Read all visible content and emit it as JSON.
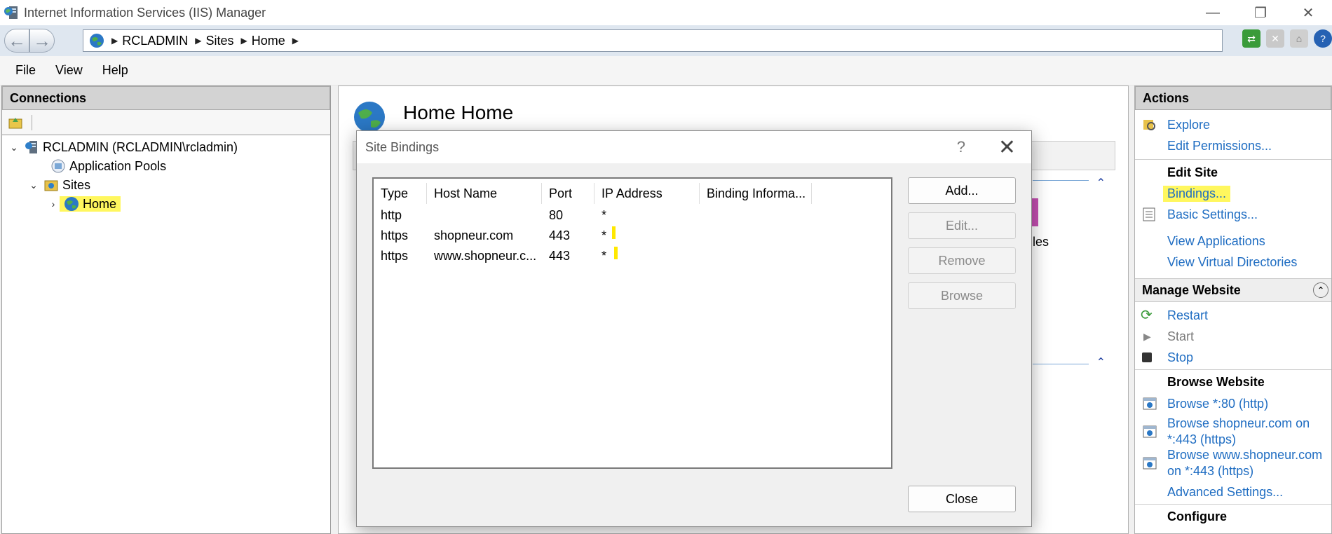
{
  "window": {
    "title": "Internet Information Services (IIS) Manager",
    "minimize": "—",
    "restore": "❐",
    "close": "✕"
  },
  "address": {
    "back": "←",
    "forward": "→",
    "crumbs": [
      "RCLADMIN",
      "Sites",
      "Home"
    ]
  },
  "menu": [
    "File",
    "View",
    "Help"
  ],
  "connections": {
    "header": "Connections",
    "server": "RCLADMIN (RCLADMIN\\rcladmin)",
    "app_pools": "Application Pools",
    "sites": "Sites",
    "home": "Home"
  },
  "center": {
    "title": "Home Home",
    "partial_text": "les"
  },
  "dialog": {
    "title": "Site Bindings",
    "help": "?",
    "close_x": "✕",
    "columns": [
      "Type",
      "Host Name",
      "Port",
      "IP Address",
      "Binding Informa..."
    ],
    "rows": [
      {
        "type": "http",
        "host": "",
        "port": "80",
        "ip": "*"
      },
      {
        "type": "https",
        "host": "shopneur.com",
        "port": "443",
        "ip": "*"
      },
      {
        "type": "https",
        "host": "www.shopneur.c...",
        "port": "443",
        "ip": "*"
      }
    ],
    "buttons": {
      "add": "Add...",
      "edit": "Edit...",
      "remove": "Remove",
      "browse": "Browse",
      "close": "Close"
    }
  },
  "actions": {
    "header": "Actions",
    "explore": "Explore",
    "edit_permissions": "Edit Permissions...",
    "edit_site": "Edit Site",
    "bindings": "Bindings...",
    "basic_settings": "Basic Settings...",
    "view_applications": "View Applications",
    "view_virtual_directories": "View Virtual Directories",
    "manage_website": "Manage Website",
    "restart": "Restart",
    "start": "Start",
    "stop": "Stop",
    "browse_website": "Browse Website",
    "browse_80": "Browse *:80 (http)",
    "browse_shopneur_1": "Browse shopneur.com on",
    "browse_shopneur_2": "*:443 (https)",
    "browse_www_1": "Browse www.shopneur.com",
    "browse_www_2": "on *:443 (https)",
    "advanced_settings": "Advanced Settings...",
    "configure": "Configure"
  }
}
